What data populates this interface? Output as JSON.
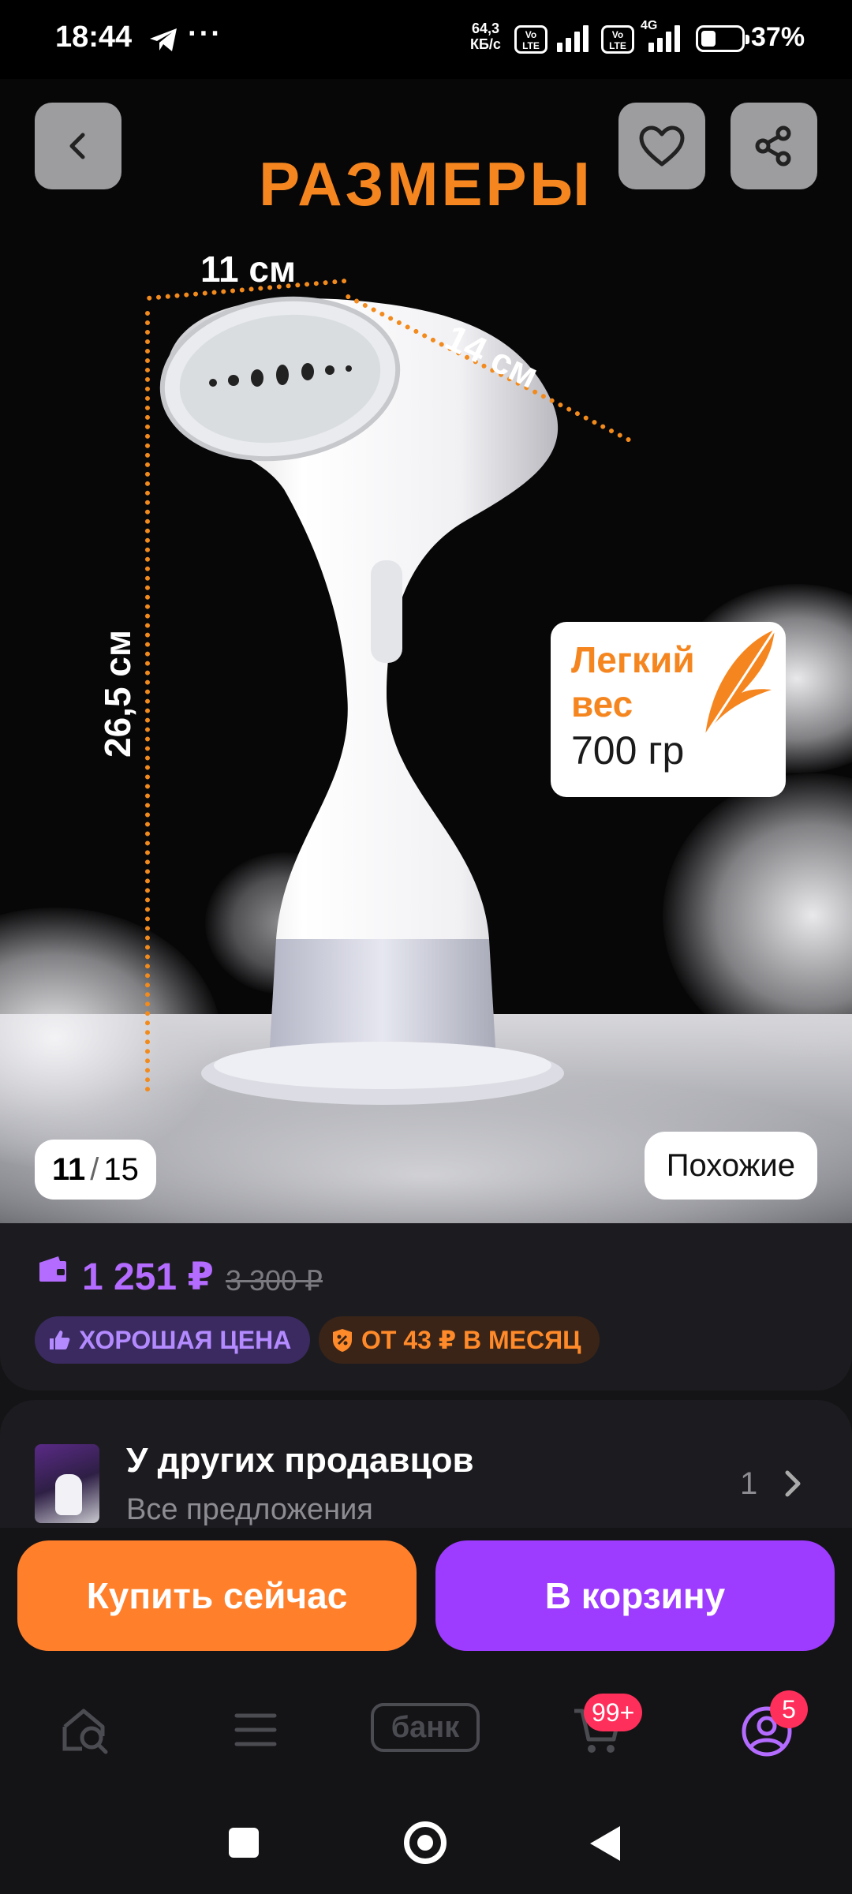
{
  "status_bar": {
    "time": "18:44",
    "dots": "···",
    "net_speed_value": "64,3",
    "net_speed_unit": "КБ/с",
    "volte_top": "Vo",
    "volte_bottom": "LTE",
    "network_4g": "4G",
    "battery_percent": "37%",
    "battery_level": 0.37
  },
  "gallery": {
    "title": "РАЗМЕРЫ",
    "dim_width": "11 см",
    "dim_depth": "14 см",
    "dim_height": "26,5 см",
    "weight_line1": "Легкий",
    "weight_line2": "вес",
    "weight_line3": "700 гр",
    "counter_current": "11",
    "counter_separator": "/",
    "counter_total": "15",
    "similar_label": "Похожие"
  },
  "price": {
    "current": "1 251 ₽",
    "old": "3 300 ₽",
    "badge_good": "ХОРОШАЯ ЦЕНА",
    "badge_installment": "ОТ 43 ₽ В МЕСЯЦ",
    "price_color": "#b46bff"
  },
  "sellers": {
    "title": "У других продавцов",
    "subtitle": "Все предложения",
    "count": "1"
  },
  "actions": {
    "buy_now": "Купить сейчас",
    "add_to_cart": "В корзину"
  },
  "bottom_nav": {
    "bank_label": "банк",
    "cart_badge": "99+",
    "profile_badge": "5"
  },
  "colors": {
    "accent_orange": "#ff7f2a",
    "accent_purple": "#9d3bff",
    "badge_red": "#ff2f5b"
  }
}
